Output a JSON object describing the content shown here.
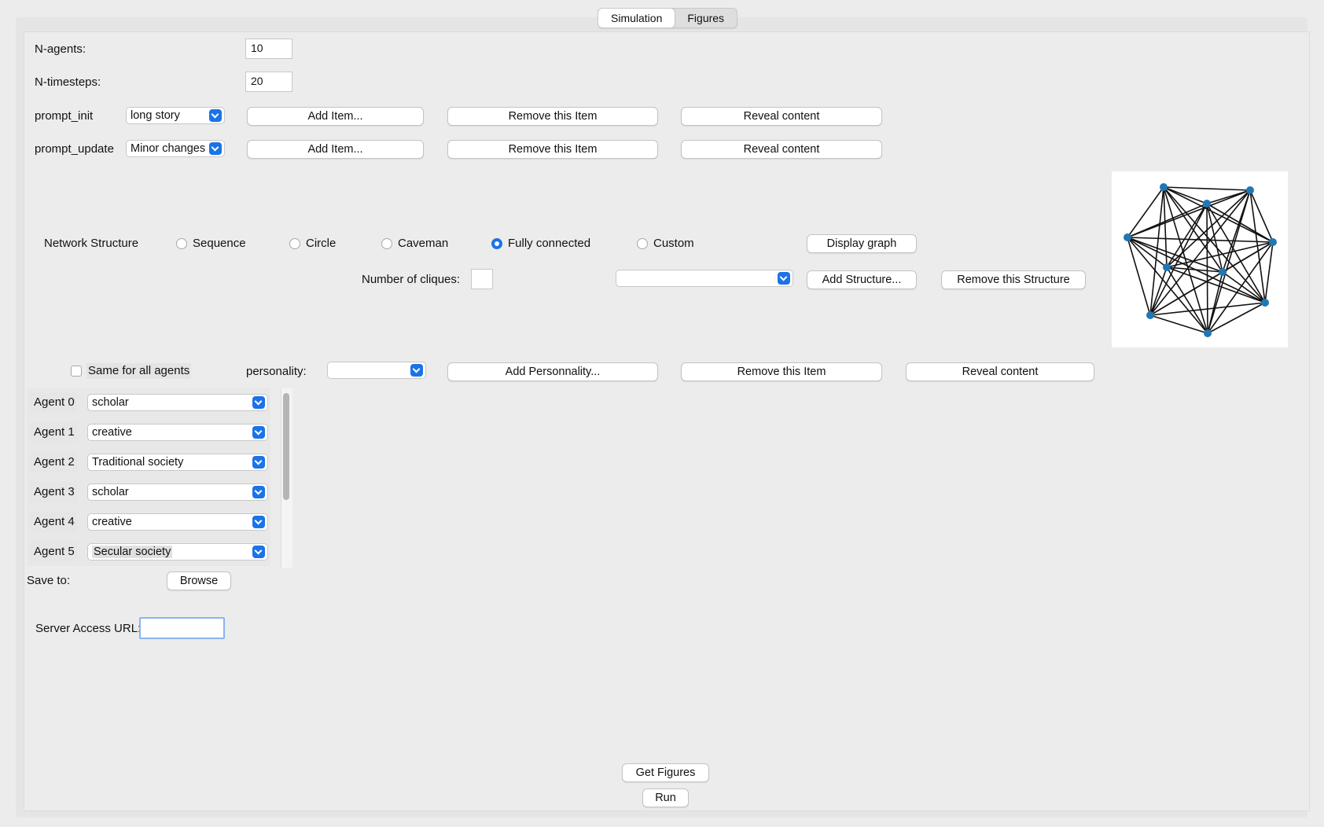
{
  "tabs": [
    {
      "label": "Simulation",
      "active": true
    },
    {
      "label": "Figures",
      "active": false
    }
  ],
  "fields": {
    "n_agents": {
      "label": "N-agents:",
      "value": "10"
    },
    "n_timesteps": {
      "label": "N-timesteps:",
      "value": "20"
    }
  },
  "prompt_init": {
    "label": "prompt_init",
    "selected": "long story",
    "add": "Add Item...",
    "remove": "Remove this Item",
    "reveal": "Reveal content"
  },
  "prompt_update": {
    "label": "prompt_update",
    "selected": "Minor changes",
    "add": "Add Item...",
    "remove": "Remove this Item",
    "reveal": "Reveal content"
  },
  "network": {
    "label": "Network Structure",
    "options": [
      {
        "label": "Sequence",
        "selected": false
      },
      {
        "label": "Circle",
        "selected": false
      },
      {
        "label": "Caveman",
        "selected": false
      },
      {
        "label": "Fully connected",
        "selected": true
      },
      {
        "label": "Custom",
        "selected": false
      }
    ],
    "display_graph": "Display graph",
    "cliques_label": "Number of cliques:",
    "cliques_value": "",
    "structure_selected": "",
    "add_structure": "Add Structure...",
    "remove_structure": "Remove this Structure"
  },
  "personality": {
    "same_for_all": "Same for all agents",
    "same_checked": false,
    "label": "personality:",
    "selected": "",
    "add": "Add Personnality...",
    "remove": "Remove this Item",
    "reveal": "Reveal content"
  },
  "agents": [
    {
      "label": "Agent 0",
      "value": "scholar"
    },
    {
      "label": "Agent 1",
      "value": "creative"
    },
    {
      "label": "Agent 2",
      "value": "Traditional society"
    },
    {
      "label": "Agent 3",
      "value": "scholar"
    },
    {
      "label": "Agent 4",
      "value": "creative"
    },
    {
      "label": "Agent 5",
      "value": "Secular society"
    }
  ],
  "save": {
    "label": "Save to:",
    "browse": "Browse"
  },
  "server": {
    "label": "Server Access URL:",
    "value": ""
  },
  "actions": {
    "get_figures": "Get Figures",
    "run": "Run"
  },
  "graph": {
    "nodes": 10,
    "edge_color": "#111111",
    "node_color": "#1f77b4"
  }
}
